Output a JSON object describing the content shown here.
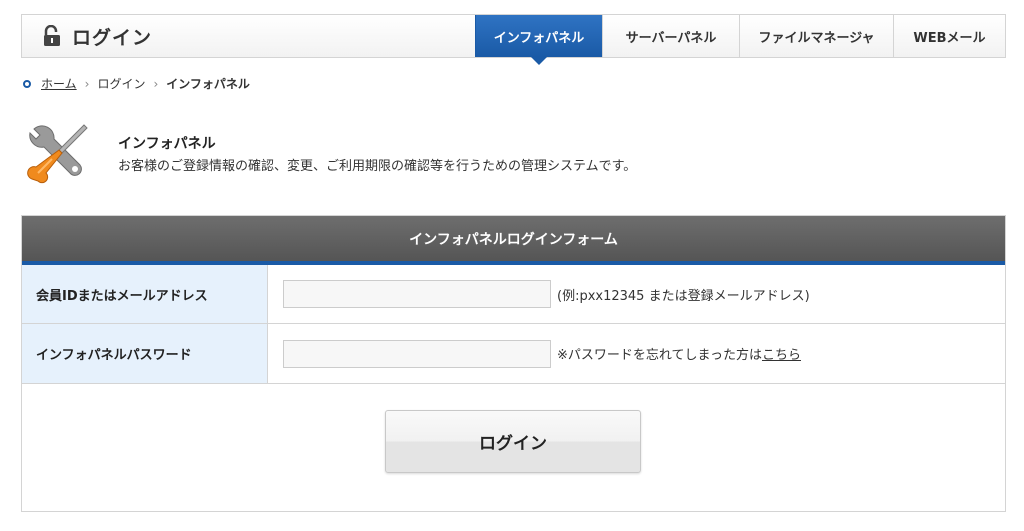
{
  "header": {
    "title": "ログイン",
    "tabs": [
      {
        "label": "インフォパネル",
        "active": true
      },
      {
        "label": "サーバーパネル",
        "active": false
      },
      {
        "label": "ファイルマネージャ",
        "active": false
      },
      {
        "label": "WEBメール",
        "active": false
      }
    ]
  },
  "breadcrumb": {
    "items": [
      "ホーム",
      "ログイン",
      "インフォパネル"
    ],
    "separator": "›"
  },
  "intro": {
    "icon": "tools-icon",
    "title": "インフォパネル",
    "description": "お客様のご登録情報の確認、変更、ご利用期限の確認等を行うための管理システムです。"
  },
  "form": {
    "heading": "インフォパネルログインフォーム",
    "fields": [
      {
        "label": "会員IDまたはメールアドレス",
        "value": "",
        "hint": "(例:pxx12345 または登録メールアドレス)"
      },
      {
        "label": "インフォパネルパスワード",
        "value": "",
        "hint": "※パスワードを忘れてしまった方は",
        "hint_link": "こちら"
      }
    ],
    "submit_label": "ログイン"
  },
  "colors": {
    "accent": "#1a5aa6",
    "label_bg": "#e6f1fc",
    "form_head_bg": "#5f5f5f"
  }
}
